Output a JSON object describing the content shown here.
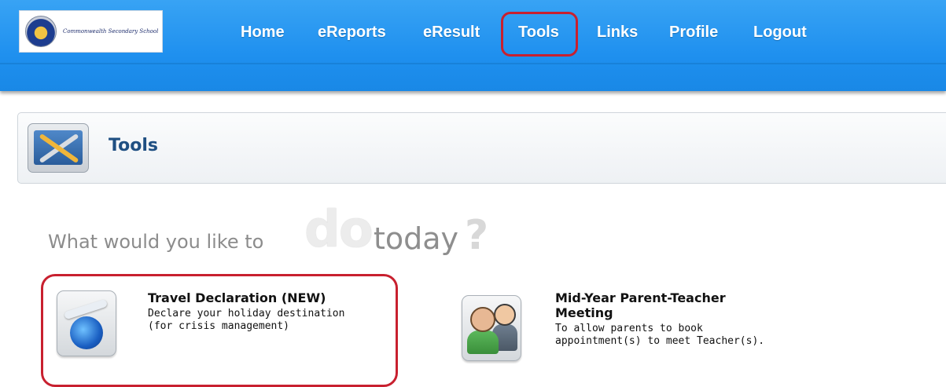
{
  "header": {
    "logo_text": "Commonwealth Secondary School",
    "nav": [
      {
        "label": "Home"
      },
      {
        "label": "eReports"
      },
      {
        "label": "eResult"
      },
      {
        "label": "Tools"
      },
      {
        "label": "Links"
      },
      {
        "label": "Profile"
      },
      {
        "label": "Logout"
      }
    ],
    "active_nav": "Tools",
    "colors": {
      "bar": "#1f90ef",
      "highlight": "#c8202f"
    }
  },
  "page": {
    "title": "Tools",
    "icon": "tools-icon"
  },
  "tagline": {
    "part1": "What would you like to",
    "part2": "do",
    "part3": "today",
    "part4": "?"
  },
  "cards": [
    {
      "title": "Travel Declaration (NEW)",
      "desc_line1": "Declare your holiday destination",
      "desc_line2": "(for crisis management)",
      "icon": "globe-plane-icon"
    },
    {
      "title_line1": "Mid-Year Parent-Teacher",
      "title_line2": "Meeting",
      "desc_line1": "To allow parents to book",
      "desc_line2": "appointment(s) to meet Teacher(s).",
      "icon": "parent-teacher-icon"
    }
  ]
}
